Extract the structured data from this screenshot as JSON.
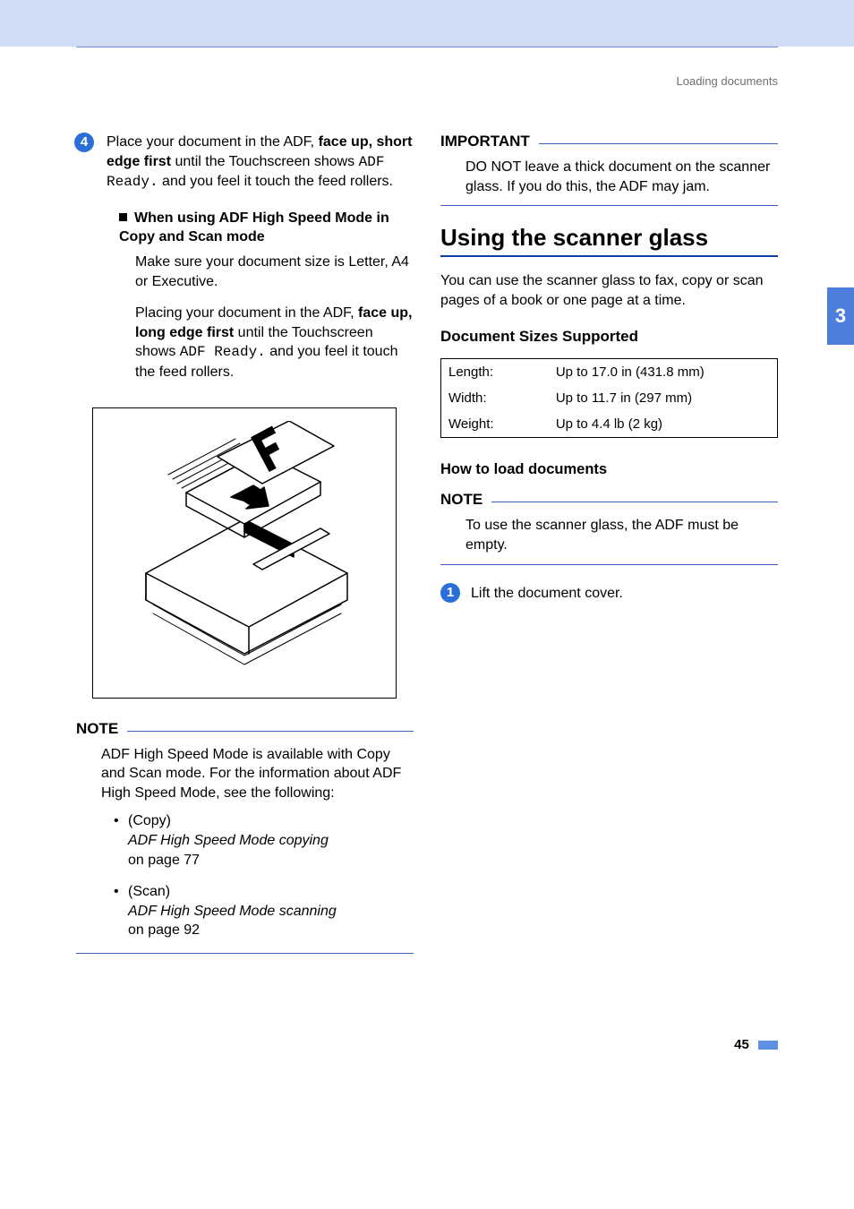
{
  "header": {
    "crumb": "Loading documents"
  },
  "sideTab": "3",
  "pageNumber": "45",
  "left": {
    "step4": {
      "num": "4",
      "p1a": "Place your document in the ADF, ",
      "p1b": "face up, short edge first",
      "p1c": " until the Touchscreen shows ",
      "p1mono": "ADF Ready.",
      "p1d": " and you feel it touch the feed rollers.",
      "subTitle": "When using ADF High Speed Mode in Copy and Scan mode",
      "subP1": "Make sure your document size is Letter, A4 or Executive.",
      "subP2a": "Placing your document in the ADF, ",
      "subP2b": "face up, long edge first",
      "subP2c": " until the Touchscreen shows ",
      "subP2mono": "ADF Ready.",
      "subP2d": " and you feel it touch the feed rollers."
    },
    "note": {
      "title": "NOTE",
      "body": "ADF High Speed Mode is available with Copy and Scan mode. For the information about ADF High Speed Mode, see the following:",
      "items": [
        {
          "tag": "(Copy)",
          "ital": "ADF High Speed Mode copying",
          "tail": "on page 77"
        },
        {
          "tag": "(Scan)",
          "ital": "ADF High Speed Mode scanning",
          "tail": "on page 92"
        }
      ]
    }
  },
  "right": {
    "important": {
      "title": "IMPORTANT",
      "body": "DO NOT leave a thick document on the scanner glass. If you do this, the ADF may jam."
    },
    "h2": "Using the scanner glass",
    "intro": "You can use the scanner glass to fax, copy or scan pages of a book or one page at a time.",
    "sizesHeading": "Document Sizes Supported",
    "table": {
      "rows": [
        {
          "k": "Length:",
          "v": "Up to 17.0 in (431.8 mm)"
        },
        {
          "k": "Width:",
          "v": "Up to 11.7 in (297 mm)"
        },
        {
          "k": "Weight:",
          "v": "Up to 4.4 lb (2 kg)"
        }
      ]
    },
    "howTo": "How to load documents",
    "note": {
      "title": "NOTE",
      "body": "To use the scanner glass, the ADF must be empty."
    },
    "step1": {
      "num": "1",
      "text": "Lift the document cover."
    }
  }
}
